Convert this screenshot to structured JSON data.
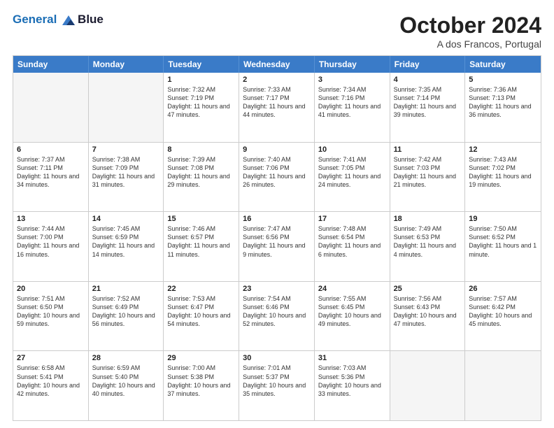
{
  "logo": {
    "line1": "General",
    "line2": "Blue"
  },
  "title": "October 2024",
  "subtitle": "A dos Francos, Portugal",
  "header_days": [
    "Sunday",
    "Monday",
    "Tuesday",
    "Wednesday",
    "Thursday",
    "Friday",
    "Saturday"
  ],
  "weeks": [
    [
      {
        "day": "",
        "info": ""
      },
      {
        "day": "",
        "info": ""
      },
      {
        "day": "1",
        "info": "Sunrise: 7:32 AM\nSunset: 7:19 PM\nDaylight: 11 hours and 47 minutes."
      },
      {
        "day": "2",
        "info": "Sunrise: 7:33 AM\nSunset: 7:17 PM\nDaylight: 11 hours and 44 minutes."
      },
      {
        "day": "3",
        "info": "Sunrise: 7:34 AM\nSunset: 7:16 PM\nDaylight: 11 hours and 41 minutes."
      },
      {
        "day": "4",
        "info": "Sunrise: 7:35 AM\nSunset: 7:14 PM\nDaylight: 11 hours and 39 minutes."
      },
      {
        "day": "5",
        "info": "Sunrise: 7:36 AM\nSunset: 7:13 PM\nDaylight: 11 hours and 36 minutes."
      }
    ],
    [
      {
        "day": "6",
        "info": "Sunrise: 7:37 AM\nSunset: 7:11 PM\nDaylight: 11 hours and 34 minutes."
      },
      {
        "day": "7",
        "info": "Sunrise: 7:38 AM\nSunset: 7:09 PM\nDaylight: 11 hours and 31 minutes."
      },
      {
        "day": "8",
        "info": "Sunrise: 7:39 AM\nSunset: 7:08 PM\nDaylight: 11 hours and 29 minutes."
      },
      {
        "day": "9",
        "info": "Sunrise: 7:40 AM\nSunset: 7:06 PM\nDaylight: 11 hours and 26 minutes."
      },
      {
        "day": "10",
        "info": "Sunrise: 7:41 AM\nSunset: 7:05 PM\nDaylight: 11 hours and 24 minutes."
      },
      {
        "day": "11",
        "info": "Sunrise: 7:42 AM\nSunset: 7:03 PM\nDaylight: 11 hours and 21 minutes."
      },
      {
        "day": "12",
        "info": "Sunrise: 7:43 AM\nSunset: 7:02 PM\nDaylight: 11 hours and 19 minutes."
      }
    ],
    [
      {
        "day": "13",
        "info": "Sunrise: 7:44 AM\nSunset: 7:00 PM\nDaylight: 11 hours and 16 minutes."
      },
      {
        "day": "14",
        "info": "Sunrise: 7:45 AM\nSunset: 6:59 PM\nDaylight: 11 hours and 14 minutes."
      },
      {
        "day": "15",
        "info": "Sunrise: 7:46 AM\nSunset: 6:57 PM\nDaylight: 11 hours and 11 minutes."
      },
      {
        "day": "16",
        "info": "Sunrise: 7:47 AM\nSunset: 6:56 PM\nDaylight: 11 hours and 9 minutes."
      },
      {
        "day": "17",
        "info": "Sunrise: 7:48 AM\nSunset: 6:54 PM\nDaylight: 11 hours and 6 minutes."
      },
      {
        "day": "18",
        "info": "Sunrise: 7:49 AM\nSunset: 6:53 PM\nDaylight: 11 hours and 4 minutes."
      },
      {
        "day": "19",
        "info": "Sunrise: 7:50 AM\nSunset: 6:52 PM\nDaylight: 11 hours and 1 minute."
      }
    ],
    [
      {
        "day": "20",
        "info": "Sunrise: 7:51 AM\nSunset: 6:50 PM\nDaylight: 10 hours and 59 minutes."
      },
      {
        "day": "21",
        "info": "Sunrise: 7:52 AM\nSunset: 6:49 PM\nDaylight: 10 hours and 56 minutes."
      },
      {
        "day": "22",
        "info": "Sunrise: 7:53 AM\nSunset: 6:47 PM\nDaylight: 10 hours and 54 minutes."
      },
      {
        "day": "23",
        "info": "Sunrise: 7:54 AM\nSunset: 6:46 PM\nDaylight: 10 hours and 52 minutes."
      },
      {
        "day": "24",
        "info": "Sunrise: 7:55 AM\nSunset: 6:45 PM\nDaylight: 10 hours and 49 minutes."
      },
      {
        "day": "25",
        "info": "Sunrise: 7:56 AM\nSunset: 6:43 PM\nDaylight: 10 hours and 47 minutes."
      },
      {
        "day": "26",
        "info": "Sunrise: 7:57 AM\nSunset: 6:42 PM\nDaylight: 10 hours and 45 minutes."
      }
    ],
    [
      {
        "day": "27",
        "info": "Sunrise: 6:58 AM\nSunset: 5:41 PM\nDaylight: 10 hours and 42 minutes."
      },
      {
        "day": "28",
        "info": "Sunrise: 6:59 AM\nSunset: 5:40 PM\nDaylight: 10 hours and 40 minutes."
      },
      {
        "day": "29",
        "info": "Sunrise: 7:00 AM\nSunset: 5:38 PM\nDaylight: 10 hours and 37 minutes."
      },
      {
        "day": "30",
        "info": "Sunrise: 7:01 AM\nSunset: 5:37 PM\nDaylight: 10 hours and 35 minutes."
      },
      {
        "day": "31",
        "info": "Sunrise: 7:03 AM\nSunset: 5:36 PM\nDaylight: 10 hours and 33 minutes."
      },
      {
        "day": "",
        "info": ""
      },
      {
        "day": "",
        "info": ""
      }
    ]
  ]
}
